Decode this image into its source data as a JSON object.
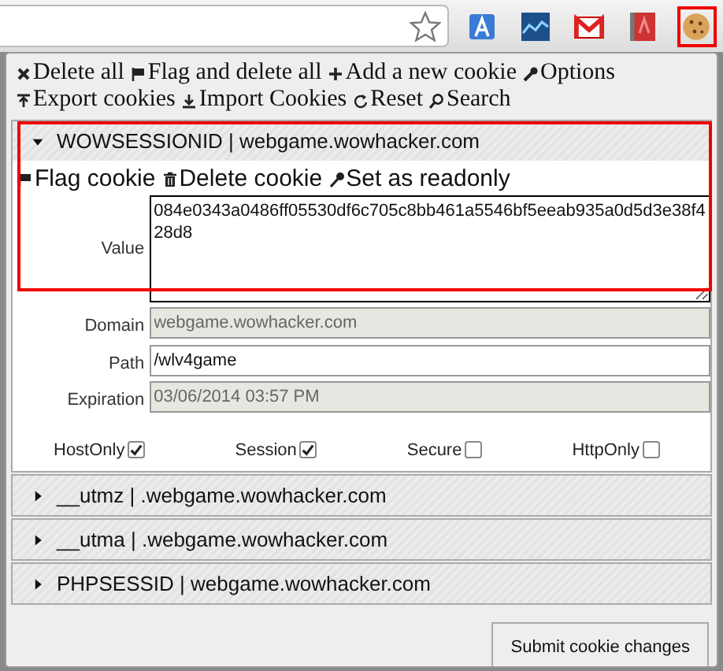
{
  "browser": {
    "extensions": [
      {
        "kind": "translate",
        "selected": false
      },
      {
        "kind": "chart",
        "selected": false
      },
      {
        "kind": "mail",
        "selected": false
      },
      {
        "kind": "book",
        "selected": false
      },
      {
        "kind": "cookie",
        "selected": true
      }
    ]
  },
  "menu": [
    {
      "kind": "x",
      "label": "Delete all"
    },
    {
      "kind": "flag",
      "label": "Flag and delete all"
    },
    {
      "kind": "plus",
      "label": "Add a new cookie"
    },
    {
      "kind": "wrench",
      "label": "Options"
    },
    {
      "kind": "export",
      "label": "Export cookies"
    },
    {
      "kind": "import",
      "label": "Import Cookies"
    },
    {
      "kind": "reset",
      "label": "Reset"
    },
    {
      "kind": "search",
      "label": "Search"
    }
  ],
  "cookies": [
    {
      "label": "WOWSESSIONID | webgame.wowhacker.com",
      "expanded": true,
      "highlighted": true,
      "actions": [
        {
          "kind": "flag",
          "label": "Flag cookie"
        },
        {
          "kind": "trash",
          "label": "Delete cookie"
        },
        {
          "kind": "key",
          "label": "Set as readonly"
        }
      ],
      "fields": [
        {
          "label": "Value",
          "value": "084e0343a0486ff05530df6c705c8bb461a5546bf5eeab935a0d5d3e38f428d8",
          "kind": "textarea",
          "disabled": false
        },
        {
          "label": "Domain",
          "value": "webgame.wowhacker.com",
          "kind": "input",
          "disabled": true
        },
        {
          "label": "Path",
          "value": "/wlv4game",
          "kind": "input",
          "disabled": false
        },
        {
          "label": "Expiration",
          "value": "03/06/2014 03:57 PM",
          "kind": "input",
          "disabled": true
        }
      ],
      "flags": [
        {
          "label": "HostOnly",
          "checked": true
        },
        {
          "label": "Session",
          "checked": true
        },
        {
          "label": "Secure",
          "checked": false
        },
        {
          "label": "HttpOnly",
          "checked": false
        }
      ]
    },
    {
      "label": "__utmz | .webgame.wowhacker.com",
      "expanded": false,
      "highlighted": false
    },
    {
      "label": "__utma | .webgame.wowhacker.com",
      "expanded": false,
      "highlighted": false
    },
    {
      "label": "PHPSESSID | webgame.wowhacker.com",
      "expanded": false,
      "highlighted": false
    }
  ],
  "submit": "Submit cookie changes"
}
